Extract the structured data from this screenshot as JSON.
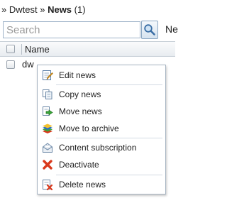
{
  "breadcrumb": {
    "prefix": "»",
    "parent": "Dwtest",
    "separator": "»",
    "current": "News",
    "count": "(1)"
  },
  "search": {
    "placeholder": "Search",
    "next_label_partial": "Ne"
  },
  "grid": {
    "columns": [
      "Name"
    ],
    "rows": [
      {
        "name": "dw"
      }
    ]
  },
  "context_menu": {
    "items": [
      {
        "label": "Edit news",
        "icon": "edit-icon"
      },
      {
        "label": "Copy news",
        "icon": "copy-icon"
      },
      {
        "label": "Move news",
        "icon": "move-icon"
      },
      {
        "label": "Move to archive",
        "icon": "archive-icon"
      },
      {
        "label": "Content subscription",
        "icon": "subscription-icon"
      },
      {
        "label": "Deactivate",
        "icon": "deactivate-icon"
      },
      {
        "label": "Delete news",
        "icon": "delete-icon"
      }
    ]
  },
  "colors": {
    "accent_border": "#a7b4c2",
    "deactivate_red": "#d9391c",
    "move_green": "#3aa63a"
  }
}
